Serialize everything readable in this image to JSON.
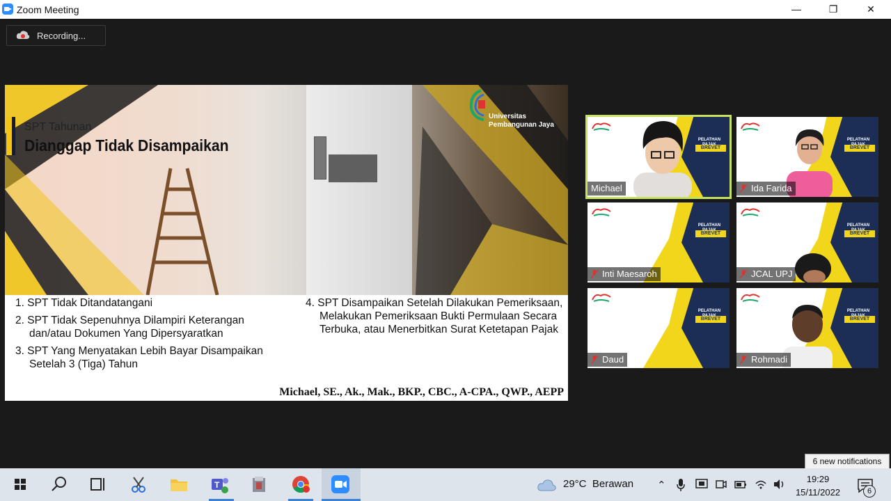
{
  "window": {
    "title": "Zoom Meeting",
    "minimize": "—",
    "restore": "❐",
    "close": "✕"
  },
  "recording": {
    "label": "Recording..."
  },
  "slide": {
    "subtitle": "SPT Tahunan",
    "title": "Dianggap Tidak Disampaikan",
    "university_line1": "Universitas",
    "university_line2": "Pembangunan Jaya",
    "left_items": [
      "1. SPT Tidak Ditandatangani",
      "2. SPT Tidak Sepenuhnya Dilampiri Keterangan dan/atau Dokumen Yang Dipersyaratkan",
      "3. SPT Yang Menyatakan Lebih Bayar Disampaikan Setelah 3 (Tiga) Tahun"
    ],
    "right_items": [
      "4. SPT Disampaikan Setelah Dilakukan Pemeriksaan, Melakukan Pemeriksaan Bukti Permulaan Secara Terbuka, atau Menerbitkan Surat Ketetapan Pajak"
    ],
    "author": "Michael, SE., Ak., Mak., BKP., CBC., A-CPA., QWP., AEPP"
  },
  "participants": [
    {
      "name": "Michael",
      "muted": false,
      "active": true
    },
    {
      "name": "Ida Farida",
      "muted": true,
      "active": false
    },
    {
      "name": "Inti Maesaroh",
      "muted": true,
      "active": false
    },
    {
      "name": "JCAL UPJ",
      "muted": true,
      "active": false
    },
    {
      "name": "Daud",
      "muted": true,
      "active": false
    },
    {
      "name": "Rohmadi",
      "muted": true,
      "active": false
    }
  ],
  "tile_banner": {
    "line1": "PELATHAN PAJAK",
    "line2": "BREVET A&B"
  },
  "notification_tip": "6 new notifications",
  "taskbar": {
    "weather_temp": "29°C",
    "weather_desc": "Berawan",
    "time": "19:29",
    "date": "15/11/2022",
    "notif_count": "6",
    "apps": [
      "start-icon",
      "search-icon",
      "task-view-icon",
      "snipping-tool-icon",
      "file-explorer-icon",
      "teams-icon",
      "archive-icon",
      "chrome-icon",
      "zoom-icon"
    ]
  }
}
